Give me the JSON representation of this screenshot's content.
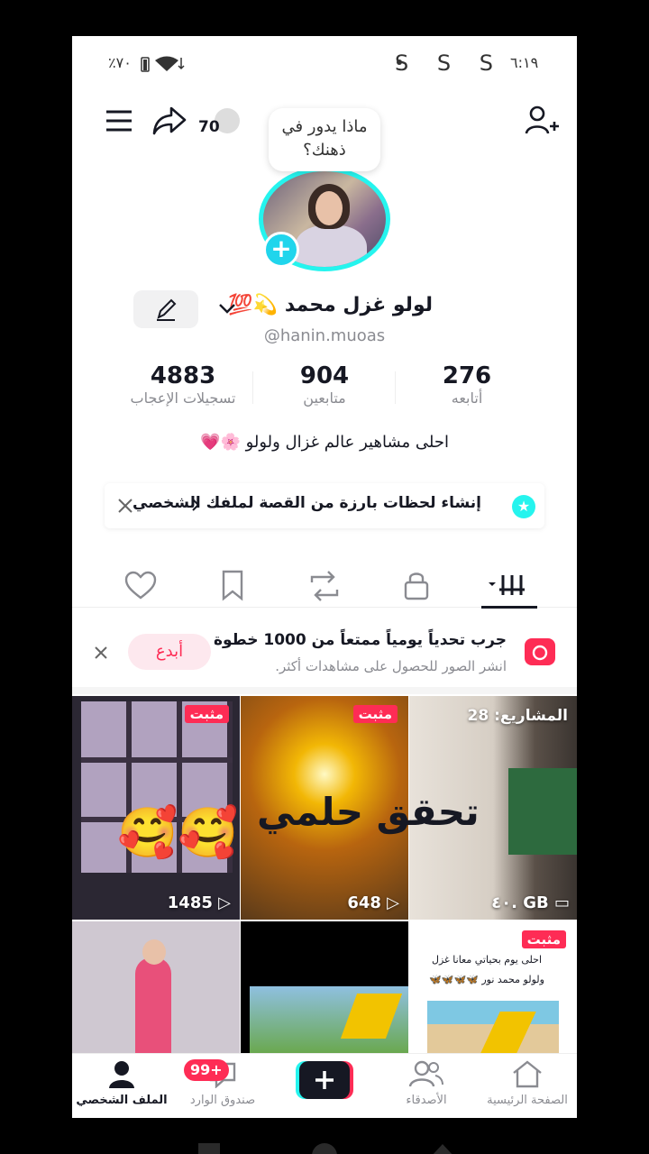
{
  "status": {
    "time": "٦:١٩",
    "apps": "S S S",
    "battery": "٪٧٠"
  },
  "header": {
    "coins": "70"
  },
  "note_bubble": "ماذا يدور في ذهنك؟",
  "profile": {
    "name": "لولو غزل محمد 💫💯",
    "handle": "@hanin.muoas",
    "bio": "احلى مشاهير عالم غزال ولولو 🌸💗"
  },
  "stats": [
    {
      "value": "4883",
      "label": "تسجيلات الإعجاب"
    },
    {
      "value": "904",
      "label": "متابعين"
    },
    {
      "value": "276",
      "label": "أتابعه"
    }
  ],
  "story_banner": {
    "text": "إنشاء لحظات بارزة من القصة لملفك الشخصي"
  },
  "challenge": {
    "title": "جرب تحدياً يومياً ممتعاً من 1000 خطوة",
    "subtitle": "انشر الصور للحصول على مشاهدات أكثر.",
    "button": "أبدع"
  },
  "grid": {
    "pinned_label": "مثبت",
    "projects_label": "المشاريع: 28",
    "storage_label": "٤٠. GB",
    "video1_views": "1485",
    "video2_views": "648",
    "overlay_text": "تحقق حلمي",
    "card_text": "احلى يوم بحياتي معانا غزل ولولو محمد نور 🦋🦋🦋🦋"
  },
  "nav": {
    "profile": "الملف الشخصي",
    "inbox": "صندوق الوارد",
    "inbox_badge": "99+",
    "friends": "الأصدقاء",
    "home": "الصفحة الرئيسية"
  },
  "colors": {
    "accent": "#fe2c55",
    "cyan": "#25f4ee",
    "text": "#161823",
    "muted": "#8a8b91"
  }
}
